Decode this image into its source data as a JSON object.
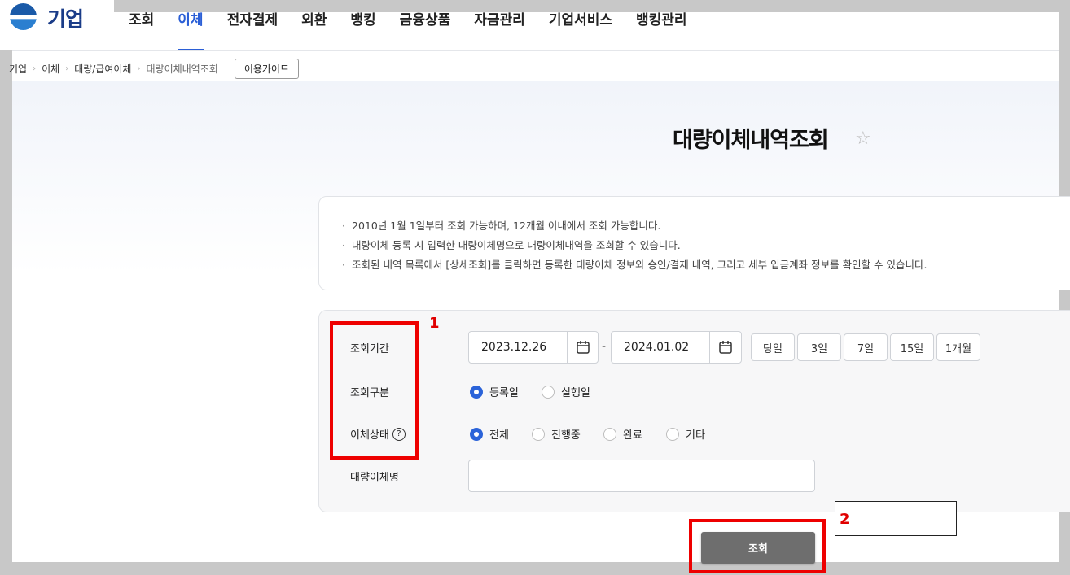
{
  "logo": {
    "text": "기업"
  },
  "nav": {
    "items": [
      "조회",
      "이체",
      "전자결제",
      "외환",
      "뱅킹",
      "금융상품",
      "자금관리",
      "기업서비스",
      "뱅킹관리"
    ],
    "active_index": 1
  },
  "breadcrumb": {
    "items": [
      "기업",
      "이체",
      "대량/급여이체",
      "대량이체내역조회"
    ],
    "guide_button": "이용가이드"
  },
  "page": {
    "title": "대량이체내역조회"
  },
  "notice": {
    "lines": [
      "2010년 1월 1일부터 조회 가능하며, 12개월 이내에서 조회 가능합니다.",
      "대량이체 등록 시 입력한 대량이체명으로 대량이체내역을 조회할 수 있습니다.",
      "조회된 내역 목록에서 [상세조회]를 클릭하면 등록한 대량이체 정보와 승인/결재 내역, 그리고 세부 입금계좌 정보를 확인할 수 있습니다."
    ]
  },
  "form": {
    "period_label": "조회기간",
    "start_date": "2023.12.26",
    "end_date": "2024.01.02",
    "separator": "-",
    "period_buttons": [
      "당일",
      "3일",
      "7일",
      "15일",
      "1개월"
    ],
    "type_label": "조회구분",
    "type_options": [
      "등록일",
      "실행일"
    ],
    "type_selected": "등록일",
    "status_label": "이체상태",
    "status_help": "?",
    "status_options": [
      "전체",
      "진행중",
      "완료",
      "기타"
    ],
    "status_selected": "전체",
    "name_label": "대량이체명",
    "name_value": ""
  },
  "search_button": "조회",
  "annotations": {
    "marker1": "1",
    "marker2": "2",
    "color": "#ee0000"
  }
}
